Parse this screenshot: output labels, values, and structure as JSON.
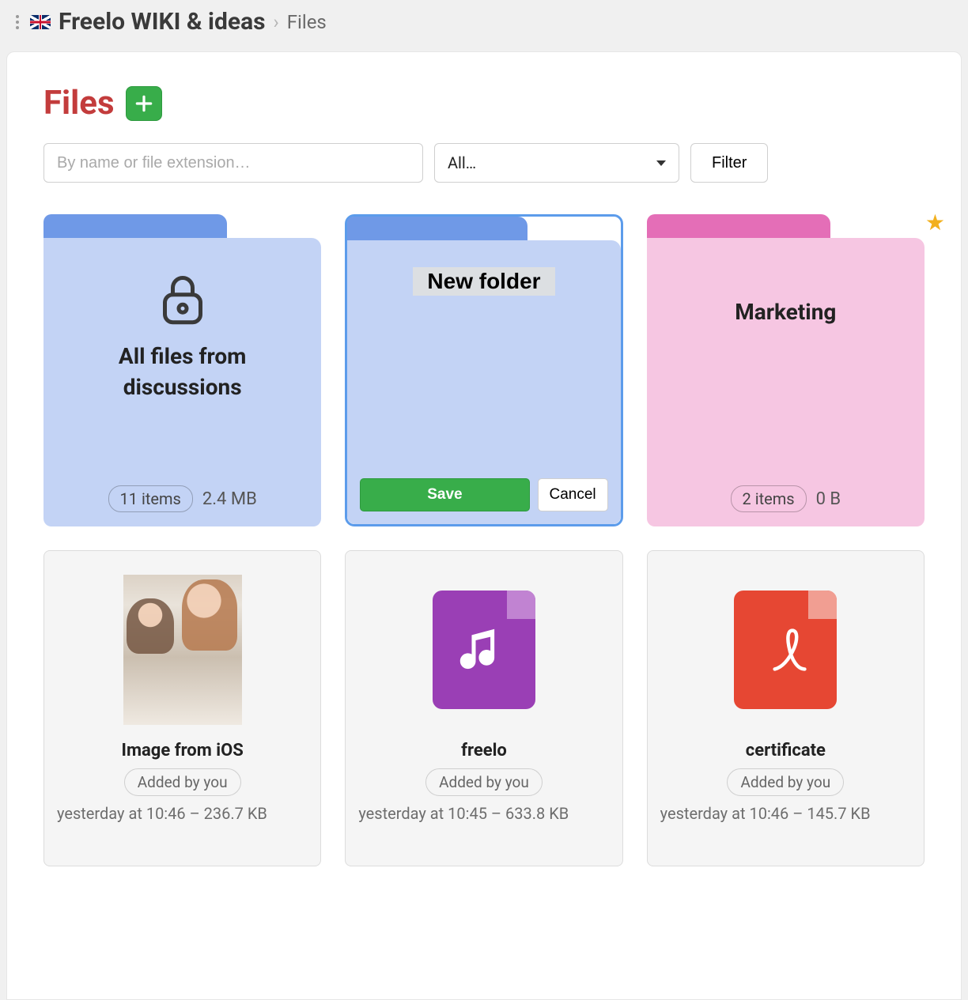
{
  "breadcrumb": {
    "project": "Freelo WIKI & ideas",
    "current": "Files"
  },
  "page": {
    "title": "Files"
  },
  "search": {
    "placeholder": "By name or file extension…"
  },
  "filter_select": {
    "value": "All…"
  },
  "filter_button": "Filter",
  "new_folder": {
    "name": "New folder",
    "save": "Save",
    "cancel": "Cancel"
  },
  "folders": [
    {
      "icon": "lock-folder",
      "title": "All files from discussions",
      "items": "11 items",
      "size": "2.4 MB"
    },
    {
      "title": "Marketing",
      "items": "2 items",
      "size": "0 B",
      "starred": true
    }
  ],
  "files": [
    {
      "name": "Image from iOS",
      "type": "image",
      "added_by": "Added by you",
      "meta": "yesterday at 10:46 – 236.7 KB"
    },
    {
      "name": "freelo",
      "type": "audio",
      "added_by": "Added by you",
      "meta": "yesterday at 10:45 – 633.8 KB"
    },
    {
      "name": "certificate",
      "type": "pdf",
      "added_by": "Added by you",
      "meta": "yesterday at 10:46 – 145.7 KB"
    }
  ]
}
